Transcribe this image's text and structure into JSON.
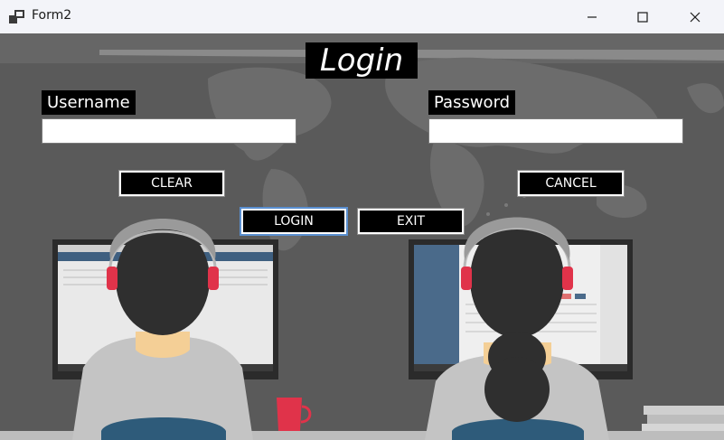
{
  "window": {
    "title": "Form2",
    "icon": "app-window-icon",
    "controls": [
      "minimize-icon",
      "maximize-icon",
      "close-icon"
    ]
  },
  "form": {
    "heading": "Login",
    "username_label": "Username",
    "username_value": "",
    "password_label": "Password",
    "password_value": "",
    "buttons": {
      "clear": "CLEAR",
      "cancel": "CANCEL",
      "login": "LOGIN",
      "exit": "EXIT"
    }
  },
  "colors": {
    "titlebar_bg": "#f3f4f9",
    "background": "#5a5a5a",
    "label_bg": "#000000",
    "button_bg": "#000000",
    "button_text": "#ffffff",
    "mug": "#e0334a",
    "headset_ear": "#e0334a"
  }
}
